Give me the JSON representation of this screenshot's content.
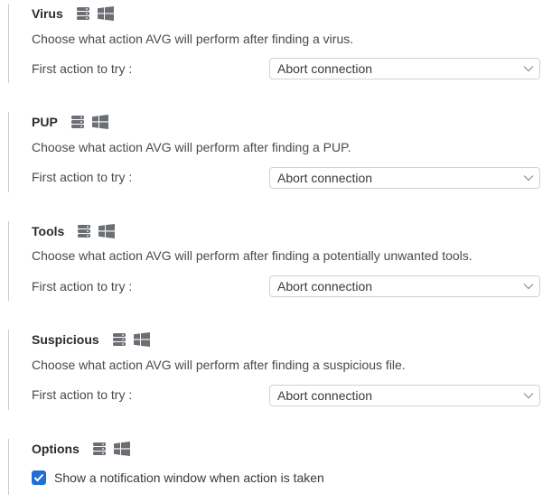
{
  "sections": [
    {
      "title": "Virus",
      "description": "Choose what action AVG will perform after finding a virus.",
      "action_label": "First action to try :",
      "action_value": "Abort connection"
    },
    {
      "title": "PUP",
      "description": "Choose what action AVG will perform after finding a PUP.",
      "action_label": "First action to try :",
      "action_value": "Abort connection"
    },
    {
      "title": "Tools",
      "description": "Choose what action AVG will perform after finding a potentially unwanted tools.",
      "action_label": "First action to try :",
      "action_value": "Abort connection"
    },
    {
      "title": "Suspicious",
      "description": "Choose what action AVG will perform after finding a suspicious file.",
      "action_label": "First action to try :",
      "action_value": "Abort connection"
    }
  ],
  "options": {
    "title": "Options",
    "notification_checkbox": {
      "label": "Show a notification window when action is taken",
      "checked": true
    }
  },
  "icons": {
    "server": "server-icon",
    "windows": "windows-icon",
    "chevron": "chevron-down-icon",
    "check": "checkmark-icon"
  },
  "colors": {
    "checkbox_accent": "#1f6fd6",
    "icon_gray": "#6b6e73",
    "border_gray": "#cfd2d8"
  }
}
